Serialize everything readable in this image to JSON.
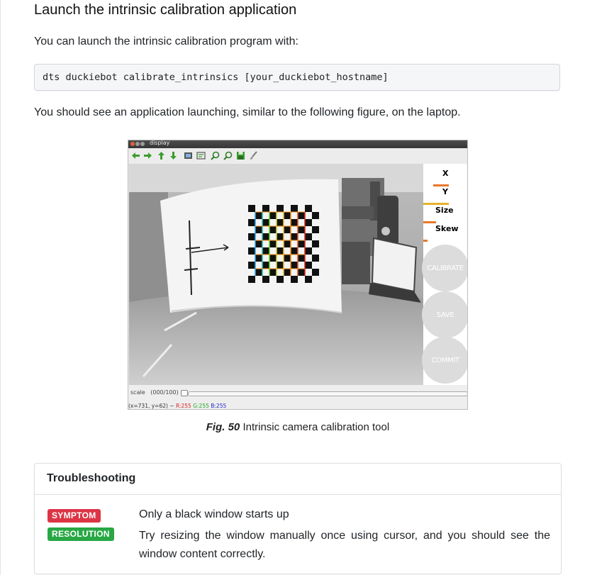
{
  "section": {
    "title": "Launch the intrinsic calibration application",
    "intro": "You can launch the intrinsic calibration program with:",
    "command": "dts duckiebot calibrate_intrinsics [your_duckiebot_hostname]",
    "after_command": "You should see an application launching, similar to the following figure, on the laptop."
  },
  "figure": {
    "window_title": "display",
    "toolbar_icons": [
      "arrow-left-icon",
      "arrow-right-icon",
      "arrow-up-icon",
      "arrow-down-icon",
      "save-image-icon",
      "properties-icon",
      "zoom-in-icon",
      "zoom-out-icon",
      "save-icon",
      "brush-icon"
    ],
    "side_labels": {
      "x": "X",
      "y": "Y",
      "size": "Size",
      "skew": "Skew"
    },
    "buttons": {
      "calibrate": "CALIBRATE",
      "save": "SAVE",
      "commit": "COMMIT"
    },
    "scale_label": "scale   (000/100)",
    "status": {
      "coords": "(x=731, y=62) ~ ",
      "r": "R:255",
      "g": "G:255",
      "b": "B:255"
    },
    "caption_label": "Fig. 50",
    "caption_text": " Intrinsic camera calibration tool",
    "colors": {
      "x_bar": "#e8772a",
      "y_bar": "#e8772a",
      "size_bar": "#e6b12a",
      "skew_bar": "#e8772a"
    }
  },
  "troubleshooting": {
    "title": "Troubleshooting",
    "symptom_badge": "SYMPTOM",
    "symptom_text": "Only a black window starts up",
    "resolution_badge": "RESOLUTION",
    "resolution_text": "Try resizing the window manually once using cursor, and you should see the window content correctly.",
    "colors": {
      "symptom": "#dc3545",
      "resolution": "#28a745"
    }
  }
}
